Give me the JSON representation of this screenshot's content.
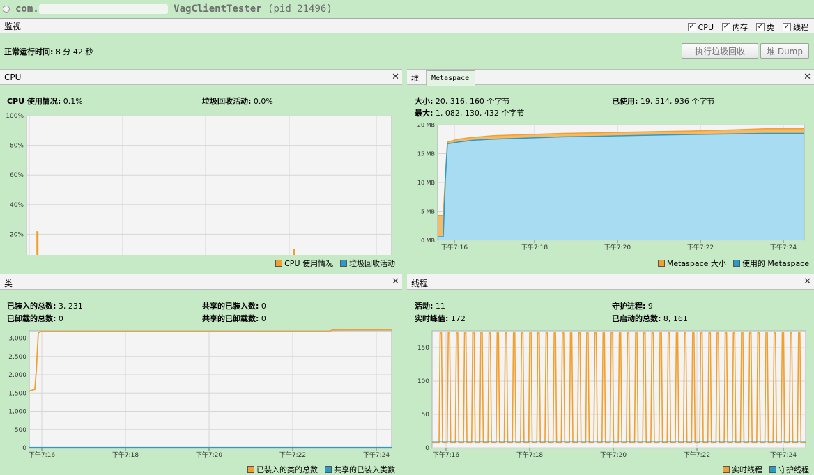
{
  "window": {
    "title_prefix": "com.",
    "app_name": "VagClientTester",
    "pid": "(pid 21496)"
  },
  "monitor_bar": {
    "label": "监视",
    "checkboxes": [
      {
        "label": "CPU",
        "checked": true
      },
      {
        "label": "内存",
        "checked": true
      },
      {
        "label": "类",
        "checked": true
      },
      {
        "label": "线程",
        "checked": true
      }
    ]
  },
  "uptime": {
    "label": "正常运行时间:",
    "value": "8 分 42 秒"
  },
  "buttons": {
    "gc": "执行垃圾回收",
    "heap_dump": "堆 Dump"
  },
  "cpu_panel": {
    "title": "CPU",
    "stat1_label": "CPU 使用情况:",
    "stat1_value": "0.1%",
    "stat2_label": "垃圾回收活动:",
    "stat2_value": "0.0%",
    "legend": [
      "CPU 使用情况",
      "垃圾回收活动"
    ]
  },
  "mem_panel": {
    "tab_heap": "堆",
    "tab_meta": "Metaspace",
    "size_label": "大小:",
    "size_value": "20, 316, 160 个字节",
    "used_label": "已使用:",
    "used_value": "19, 514, 936 个字节",
    "max_label": "最大:",
    "max_value": "1, 082, 130, 432 个字节",
    "legend": [
      "Metaspace 大小",
      "使用的 Metaspace"
    ]
  },
  "class_panel": {
    "title": "类",
    "loaded_label": "已装入的总数:",
    "loaded_value": "3, 231",
    "unloaded_label": "已卸载的总数:",
    "unloaded_value": "0",
    "shared_loaded_label": "共享的已装入数:",
    "shared_loaded_value": "0",
    "shared_unloaded_label": "共享的已卸载数:",
    "shared_unloaded_value": "0",
    "legend": [
      "已装入的类的总数",
      "共享的已装入类数"
    ]
  },
  "thread_panel": {
    "title": "线程",
    "live_label": "活动:",
    "live_value": "11",
    "peak_label": "实时峰值:",
    "peak_value": "172",
    "daemon_label": "守护进程:",
    "daemon_value": "9",
    "started_label": "已启动的总数:",
    "started_value": "8, 161",
    "legend": [
      "实时线程",
      "守护线程"
    ]
  },
  "colors": {
    "orange": "#f0a030",
    "blue": "#2a9ac8",
    "bg": "#c6e9c6"
  },
  "chart_data": [
    {
      "type": "bar",
      "title": "CPU",
      "x_ticks": [
        "下午7:16",
        "下午7:18",
        "下午7:20",
        "下午7:22",
        "下午7:24"
      ],
      "y_ticks": [
        "0%",
        "20%",
        "40%",
        "60%",
        "80%",
        "100%"
      ],
      "ylim": [
        0,
        100
      ],
      "series": [
        {
          "name": "CPU 使用情况",
          "values": [
            3,
            22,
            4,
            3,
            2,
            4,
            2,
            5,
            4,
            2,
            3,
            4,
            2,
            3,
            4,
            2,
            4,
            3,
            4,
            2,
            4,
            3,
            4,
            2,
            3,
            4,
            2,
            3,
            4,
            2,
            4,
            3,
            4,
            2,
            3,
            4,
            5,
            3,
            2,
            10,
            3,
            4,
            2,
            3,
            4,
            2,
            3,
            4,
            2,
            3,
            4,
            3,
            2,
            3
          ]
        },
        {
          "name": "垃圾回收活动",
          "values": [
            0
          ]
        }
      ]
    },
    {
      "type": "area",
      "title": "Metaspace",
      "x_ticks": [
        "下午7:16",
        "下午7:18",
        "下午7:20",
        "下午7:22",
        "下午7:24"
      ],
      "y_ticks": [
        "0 MB",
        "5 MB",
        "10 MB",
        "15 MB",
        "20 MB"
      ],
      "ylim": [
        0,
        20
      ],
      "series": [
        {
          "name": "Metaspace 大小",
          "values": [
            4.3,
            4.3,
            11,
            17,
            17.5,
            17.8,
            18.1,
            18.3,
            18.5,
            18.6,
            18.7,
            18.8,
            18.9,
            19.1,
            19.3,
            19.3,
            19.3
          ]
        },
        {
          "name": "使用的 Metaspace",
          "values": [
            0.6,
            0.6,
            10.5,
            16.7,
            17.0,
            17.3,
            17.5,
            17.7,
            17.9,
            18.0,
            18.1,
            18.2,
            18.3,
            18.4,
            18.5,
            18.5,
            18.5
          ]
        }
      ]
    },
    {
      "type": "line",
      "title": "类",
      "x_ticks": [
        "下午7:16",
        "下午7:18",
        "下午7:20",
        "下午7:22",
        "下午7:24"
      ],
      "y_ticks": [
        "0",
        "500",
        "1,000",
        "1,500",
        "2,000",
        "2,500",
        "3,000"
      ],
      "ylim": [
        0,
        3200
      ],
      "series": [
        {
          "name": "已装入的类的总数",
          "values": [
            1550,
            1600,
            2100,
            3150,
            3180,
            3180,
            3180,
            3180,
            3180,
            3180,
            3180,
            3180,
            3180,
            3230,
            3231
          ]
        },
        {
          "name": "共享的已装入类数",
          "values": [
            0,
            0,
            0,
            0,
            0,
            0,
            0,
            0,
            0,
            0,
            0,
            0,
            0,
            0,
            0
          ]
        }
      ]
    },
    {
      "type": "line",
      "title": "线程",
      "x_ticks": [
        "下午7:16",
        "下午7:18",
        "下午7:20",
        "下午7:22",
        "下午7:24"
      ],
      "y_ticks": [
        "0",
        "50",
        "100",
        "150"
      ],
      "ylim": [
        0,
        175
      ],
      "series": [
        {
          "name": "实时线程",
          "peak": 172,
          "base": 8
        },
        {
          "name": "守护线程",
          "values": [
            9
          ]
        }
      ]
    }
  ]
}
